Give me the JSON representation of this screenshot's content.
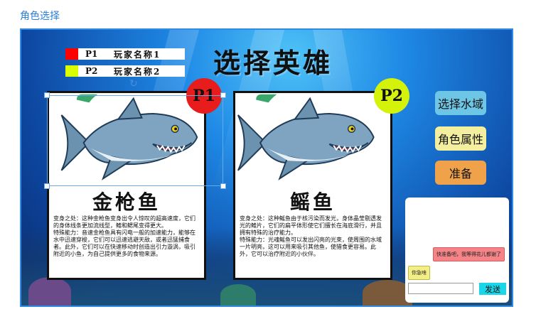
{
  "page_title": "角色选择",
  "header": {
    "title": "选择英雄"
  },
  "players": [
    {
      "tag": "P1",
      "name": "玩家名称1",
      "color": "#ff0000"
    },
    {
      "tag": "P2",
      "name": "玩家名称2",
      "color": "#d9ff00"
    }
  ],
  "cards": [
    {
      "badge": "P1",
      "badge_color": "#e81c1c",
      "name": "金枪鱼",
      "desc": "变身之处：这种金枪鱼变身出令人惊叹的超高速度，它们的身体线条更加流线型，鳍和鳃尾变得更大。\n特殊能力：音速金枪鱼具有闪电一般的加速能力，能够在水中迅速穿梭，它们可以迅速逃避天敌，或者迅猛捕食者。此外，它们可以在快速移动时创造出引力漩涡，吸引附近的小鱼，为自己提供更多的食物来源。"
    },
    {
      "badge": "P2",
      "badge_color": "#d4f20a",
      "name": "鳐鱼",
      "desc": "变身之处：这种鳐鱼由于核污染而发光，身体晶莹剔透发光的鳍片，它们的扁平体形使它们擅长在海底滑行，并且拥有特殊的治疗能力。\n特殊能力：光魂鳐鱼可以发出闪亮的光束，使周围的水域一片明亮，这可以用来吸引其他鱼，使猎食更容易。此外，它可以治疗附近的小伙伴。"
    }
  ],
  "side_buttons": [
    {
      "label": "选择水域",
      "color": "#6ec6e6"
    },
    {
      "label": "角色属性",
      "color": "#f3ef9e"
    },
    {
      "label": "准备",
      "color": "#f0a24a"
    }
  ],
  "chat": {
    "messages": [
      {
        "side": "right",
        "text": "快准备吧，我等得花儿都谢了"
      },
      {
        "side": "left",
        "text": "你急啥"
      }
    ],
    "input_value": "",
    "send_label": "发送"
  }
}
